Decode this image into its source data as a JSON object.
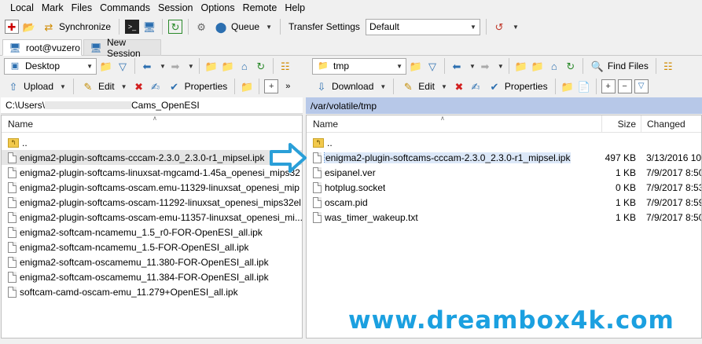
{
  "menu": [
    {
      "label": "Local",
      "key": "L"
    },
    {
      "label": "Mark",
      "key": "M"
    },
    {
      "label": "Files",
      "key": "F"
    },
    {
      "label": "Commands",
      "key": "C"
    },
    {
      "label": "Session",
      "key": "S"
    },
    {
      "label": "Options",
      "key": "O"
    },
    {
      "label": "Remote",
      "key": "R"
    },
    {
      "label": "Help",
      "key": "H"
    }
  ],
  "toolbar": {
    "synchronize_label": "Synchronize",
    "queue_label": "Queue",
    "transfer_settings_label": "Transfer Settings",
    "transfer_settings_value": "Default"
  },
  "tabs": {
    "session_label": "root@vuzero",
    "new_session_label": "New Session"
  },
  "left": {
    "location": "Desktop",
    "upload_label": "Upload",
    "edit_label": "Edit",
    "properties_label": "Properties",
    "path_prefix": "C:\\Users\\",
    "path_suffix": "Cams_OpenESI",
    "col_name": "Name",
    "files": [
      {
        "name": ".."
      },
      {
        "name": "enigma2-plugin-softcams-cccam-2.3.0_2.3.0-r1_mipsel.ipk"
      },
      {
        "name": "enigma2-plugin-softcams-linuxsat-mgcamd-1.45a_openesi_mips32"
      },
      {
        "name": "enigma2-plugin-softcams-oscam.emu-11329-linuxsat_openesi_mip"
      },
      {
        "name": "enigma2-plugin-softcams-oscam-11292-linuxsat_openesi_mips32el"
      },
      {
        "name": "enigma2-plugin-softcams-oscam-emu-11357-linuxsat_openesi_mi..."
      },
      {
        "name": "enigma2-softcam-ncamemu_1.5_r0-FOR-OpenESI_all.ipk"
      },
      {
        "name": "enigma2-softcam-ncamemu_1.5-FOR-OpenESI_all.ipk"
      },
      {
        "name": "enigma2-softcam-oscamemu_11.380-FOR-OpenESI_all.ipk"
      },
      {
        "name": "enigma2-softcam-oscamemu_11.384-FOR-OpenESI_all.ipk"
      },
      {
        "name": "softcam-camd-oscam-emu_11.279+OpenESI_all.ipk"
      }
    ]
  },
  "right": {
    "location": "tmp",
    "find_files_label": "Find Files",
    "download_label": "Download",
    "edit_label": "Edit",
    "properties_label": "Properties",
    "path": "/var/volatile/tmp",
    "col_name": "Name",
    "col_size": "Size",
    "col_changed": "Changed",
    "files": [
      {
        "name": "..",
        "size": "",
        "changed": ""
      },
      {
        "name": "enigma2-plugin-softcams-cccam-2.3.0_2.3.0-r1_mipsel.ipk",
        "size": "497 KB",
        "changed": "3/13/2016 10:"
      },
      {
        "name": "esipanel.ver",
        "size": "1 KB",
        "changed": "7/9/2017 8:50"
      },
      {
        "name": "hotplug.socket",
        "size": "0 KB",
        "changed": "7/9/2017 8:53"
      },
      {
        "name": "oscam.pid",
        "size": "1 KB",
        "changed": "7/9/2017 8:59"
      },
      {
        "name": "was_timer_wakeup.txt",
        "size": "1 KB",
        "changed": "7/9/2017 8:50"
      }
    ]
  },
  "watermark": "www.dreambox4k.com",
  "colors": {
    "accent": "#1ba0e0",
    "path_active_bg": "#b7c8e8"
  }
}
